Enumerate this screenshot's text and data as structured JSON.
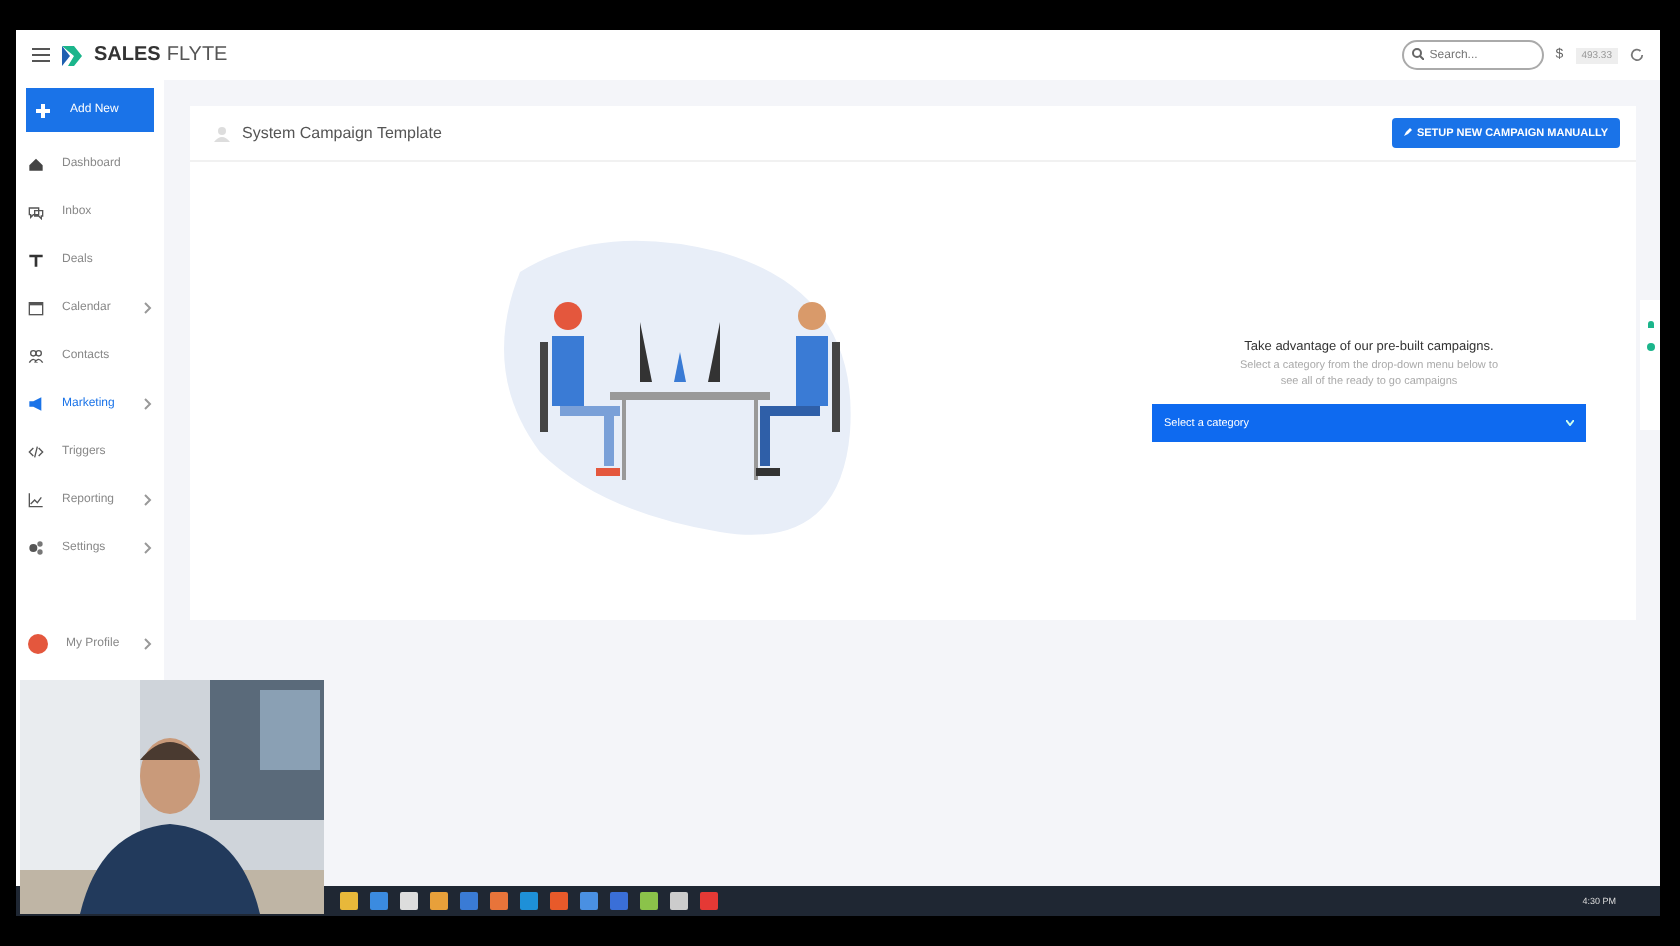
{
  "header": {
    "brand_bold": "SALES",
    "brand_light": "FLYTE",
    "search": {
      "placeholder": "Search..."
    },
    "currency": "$",
    "balance": "493.33"
  },
  "sidebar": {
    "add_button": "Add New",
    "items": [
      {
        "label": "Dashboard",
        "kind": "home",
        "submenu": false,
        "selected": false
      },
      {
        "label": "Inbox",
        "kind": "chat",
        "submenu": false,
        "selected": false
      },
      {
        "label": "Deals",
        "kind": "deals",
        "submenu": false,
        "selected": false
      },
      {
        "label": "Calendar",
        "kind": "calendar",
        "submenu": true,
        "selected": false
      },
      {
        "label": "Contacts",
        "kind": "people",
        "submenu": false,
        "selected": false
      },
      {
        "label": "Marketing",
        "kind": "megaphone",
        "submenu": true,
        "selected": true
      },
      {
        "label": "Triggers",
        "kind": "code",
        "submenu": false,
        "selected": false
      },
      {
        "label": "Reporting",
        "kind": "chart",
        "submenu": true,
        "selected": false
      },
      {
        "label": "Settings",
        "kind": "gears",
        "submenu": true,
        "selected": false
      }
    ],
    "profile": {
      "label": "My Profile",
      "submenu": true
    }
  },
  "card": {
    "title": "System Campaign Template",
    "button": "SETUP NEW CAMPAIGN MANUALLY",
    "heading": "Take advantage of our pre-built campaigns.",
    "description": "Select a category from the drop-down menu below to see all of the ready to go campaigns",
    "select": "Select a category"
  },
  "taskbar": {
    "time": "4:30 PM"
  }
}
